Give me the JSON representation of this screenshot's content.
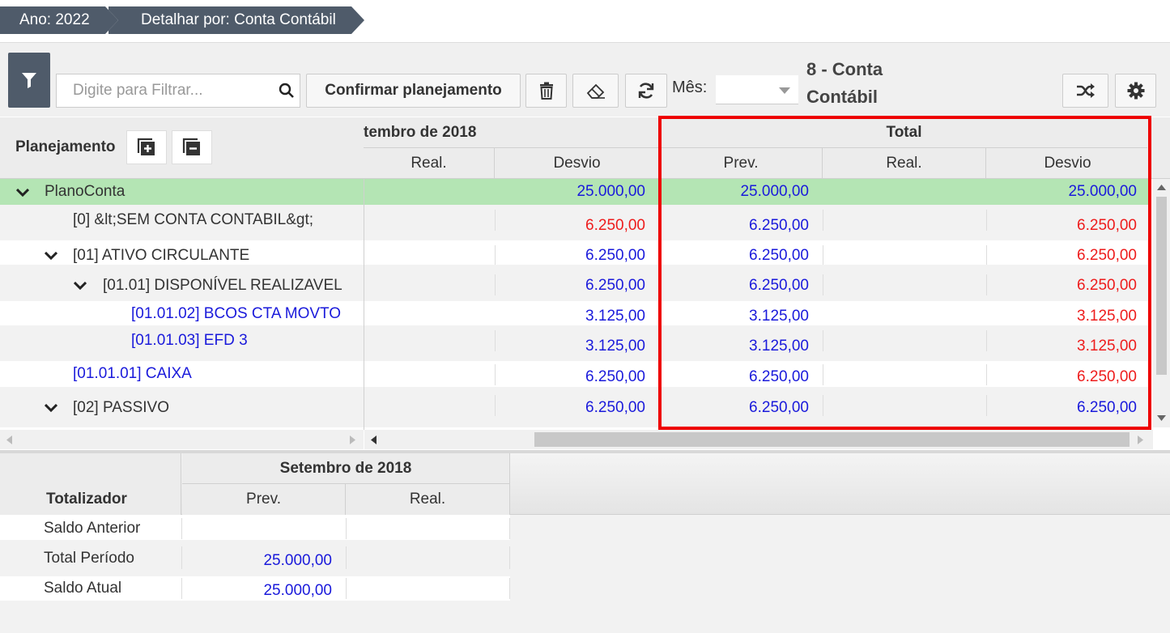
{
  "breadcrumb": {
    "year": "Ano: 2022",
    "detail": "Detalhar por: Conta Contábil"
  },
  "toolbar": {
    "filter_placeholder": "Digite para Filtrar...",
    "confirm_label": "Confirmar planejamento",
    "month_label": "Mês:",
    "month_value": "",
    "account_title": "8 - Conta Contábil"
  },
  "grid": {
    "left_header": "Planejamento",
    "month_group": "tembro de 2018",
    "total_group": "Total",
    "cols": {
      "real": "Real.",
      "desvio": "Desvio",
      "prev": "Prev."
    },
    "rows": [
      {
        "label": "PlanoConta",
        "month_desvio": "25.000,00",
        "total_prev": "25.000,00",
        "total_real": "",
        "total_desvio": "25.000,00"
      },
      {
        "label": "[0] &lt;SEM CONTA CONTABIL&gt;",
        "month_desvio": "6.250,00",
        "total_prev": "6.250,00",
        "total_real": "",
        "total_desvio": "6.250,00"
      },
      {
        "label": "[01] ATIVO CIRCULANTE",
        "month_desvio": "6.250,00",
        "total_prev": "6.250,00",
        "total_real": "",
        "total_desvio": "6.250,00"
      },
      {
        "label": "[01.01] DISPONÍVEL REALIZAVEL",
        "month_desvio": "6.250,00",
        "total_prev": "6.250,00",
        "total_real": "",
        "total_desvio": "6.250,00"
      },
      {
        "label": "[01.01.02] BCOS CTA MOVTO",
        "month_desvio": "3.125,00",
        "total_prev": "3.125,00",
        "total_real": "",
        "total_desvio": "3.125,00"
      },
      {
        "label": "[01.01.03] EFD 3",
        "month_desvio": "3.125,00",
        "total_prev": "3.125,00",
        "total_real": "",
        "total_desvio": "3.125,00"
      },
      {
        "label": "[01.01.01] CAIXA",
        "month_desvio": "6.250,00",
        "total_prev": "6.250,00",
        "total_real": "",
        "total_desvio": "6.250,00"
      },
      {
        "label": "[02] PASSIVO",
        "month_desvio": "6.250,00",
        "total_prev": "6.250,00",
        "total_real": "",
        "total_desvio": "6.250,00"
      }
    ]
  },
  "totals": {
    "header": "Totalizador",
    "month_group": "Setembro de 2018",
    "cols": {
      "prev": "Prev.",
      "real": "Real."
    },
    "rows": [
      {
        "label": "Saldo Anterior",
        "prev": "",
        "real": ""
      },
      {
        "label": "Total Período",
        "prev": "25.000,00",
        "real": ""
      },
      {
        "label": "Saldo Atual",
        "prev": "25.000,00",
        "real": ""
      }
    ]
  },
  "colors": {
    "header_dark": "#4f5b6a",
    "highlight_row": "#b4e5b4",
    "value_blue": "#1a1adb",
    "value_red": "#ee1c1c",
    "annotation_border": "#ee0000"
  }
}
